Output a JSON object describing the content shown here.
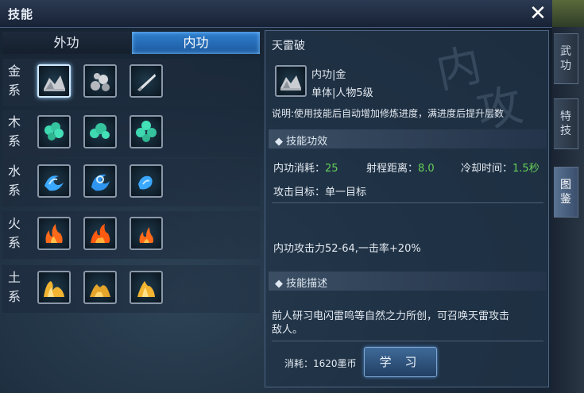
{
  "window": {
    "title": "技能",
    "close_label": "✕"
  },
  "side_tabs": [
    {
      "label_top": "武",
      "label_bottom": "功"
    },
    {
      "label_top": "特",
      "label_bottom": "技"
    },
    {
      "label_top": "图",
      "label_bottom": "鉴"
    }
  ],
  "tabs": [
    {
      "label": "外功"
    },
    {
      "label": "内功"
    }
  ],
  "rows": [
    {
      "label_top": "金",
      "label_bottom": "系",
      "icon": "rock-icon",
      "color": "#c9ccd1"
    },
    {
      "label_top": "木",
      "label_bottom": "系",
      "icon": "leaf-icon",
      "color": "#3ed9b0"
    },
    {
      "label_top": "水",
      "label_bottom": "系",
      "icon": "wave-icon",
      "color": "#3aa8ff"
    },
    {
      "label_top": "火",
      "label_bottom": "系",
      "icon": "flame-icon",
      "color": "#ff6a1a"
    },
    {
      "label_top": "土",
      "label_bottom": "系",
      "icon": "sand-icon",
      "color": "#f2b431"
    }
  ],
  "detail": {
    "skill_name": "天雷破",
    "category": "内功|金",
    "target_level": "单体|人物5级",
    "description": "说明:使用技能后自动增加修炼进度，满进度后提升层数",
    "section_effect": "技能功效",
    "cost_label": "内功消耗：",
    "cost_value": "25",
    "range_label": "射程距离：",
    "range_value": "8.0",
    "cooldown_label": "冷却时间：",
    "cooldown_value": "1.5秒",
    "target_text": "攻击目标：单一目标",
    "attack_text": "内功攻击力52-64,一击率+20%",
    "section_desc": "技能描述",
    "desc_line1": "前人研习电闪雷鸣等自然之力所创，可召唤天雷攻击",
    "desc_line2": "敌人。",
    "consume_text": "消耗：1620墨币",
    "learn_label": "学 习",
    "watermark_top": "内",
    "watermark_bottom": "攻"
  }
}
